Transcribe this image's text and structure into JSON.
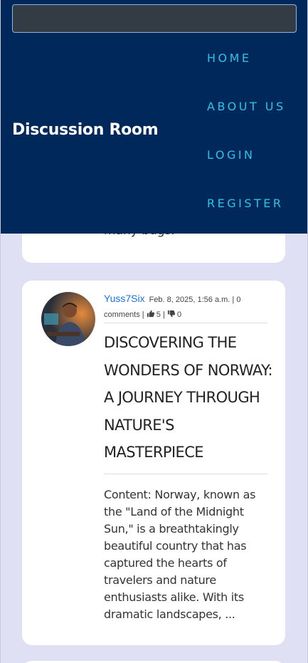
{
  "search": {
    "placeholder": ""
  },
  "navbar": {
    "brand": "Discussion Room",
    "links": [
      {
        "label": "HOME"
      },
      {
        "label": "ABOUT US"
      },
      {
        "label": "LOGIN"
      },
      {
        "label": "REGISTER"
      }
    ]
  },
  "previous_post": {
    "content_tail": "many bugs."
  },
  "post": {
    "author": "Yuss7Six",
    "date": "Feb. 8, 2025, 1:56 a.m.",
    "comments": "0 comments",
    "likes": "5",
    "dislikes": "0",
    "title": "DISCOVERING THE WONDERS OF NORWAY: A JOURNEY THROUGH NATURE'S MASTERPIECE",
    "content": "Content: Norway, known as the \"Land of the Midnight Sun,\" is a breathtakingly beautiful country that has captured the hearts of travelers and nature enthusiasts alike. With its dramatic landscapes, ...",
    "icons": {
      "like": "thumbs-up-icon",
      "dislike": "thumbs-down-icon"
    }
  },
  "colors": {
    "navbar_bg": "#00285a",
    "nav_link": "#2ac4e8",
    "page_bg": "#e0e0f5",
    "author_link": "#1a73e8"
  }
}
